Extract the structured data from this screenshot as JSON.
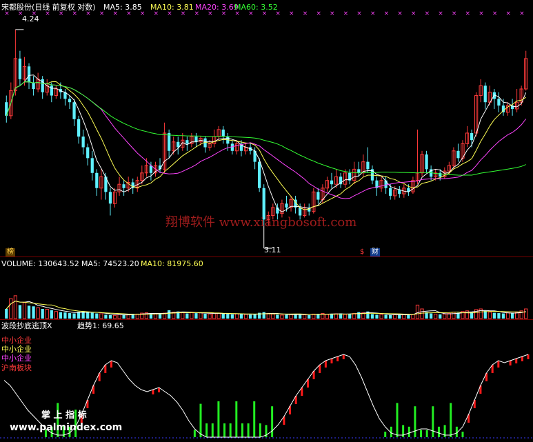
{
  "header": {
    "title": "宋都股份(日线 前复权 对数)",
    "ma5": "MA5: 3.85",
    "ma10": "MA10: 3.81",
    "ma20": "MA20: 3.69",
    "ma60": "MA60: 3.52"
  },
  "annotations": {
    "high": "4.24",
    "low": "3.11",
    "badge_left": "榜",
    "badge_dollar": "$",
    "badge_right": "财"
  },
  "volume_header": {
    "volume": "VOLUME: 130643.52",
    "ma5": "MA5: 74523.20",
    "ma10": "MA10: 81975.60"
  },
  "indicator_header": {
    "name": "波段抄底逃顶X",
    "trend": "趋势1: 69.65"
  },
  "indicator_legend": [
    "中小企业",
    "中小企业",
    "中小企业",
    "沪南板块"
  ],
  "watermarks": {
    "main": "翔博软件 www.xiangbosoft.com",
    "bottom_left": "掌 上 指 标",
    "bottom_site": "www.palmindex.com"
  },
  "colors": {
    "up": "#ff3a3a",
    "down": "#5ff0ff",
    "ma5": "#ffffff",
    "ma10": "#ffff55",
    "ma20": "#ff44ff",
    "ma60": "#33ff33",
    "separator": "#7a0000"
  },
  "chart_data": [
    {
      "type": "candlestick",
      "title": "宋都股份(日线 前复权 对数)",
      "ylim": [
        3.05,
        4.3
      ],
      "scale": "log",
      "grid": false,
      "marked_high": 4.24,
      "marked_low": 3.11,
      "candles": [
        {
          "o": 3.78,
          "c": 3.7,
          "h": 3.82,
          "l": 3.66
        },
        {
          "o": 3.7,
          "c": 3.85,
          "h": 3.9,
          "l": 3.68
        },
        {
          "o": 3.85,
          "c": 4.05,
          "h": 4.24,
          "l": 3.82
        },
        {
          "o": 4.05,
          "c": 3.92,
          "h": 4.1,
          "l": 3.88
        },
        {
          "o": 3.92,
          "c": 4.0,
          "h": 4.06,
          "l": 3.88
        },
        {
          "o": 4.0,
          "c": 3.9,
          "h": 4.02,
          "l": 3.86
        },
        {
          "o": 3.9,
          "c": 3.86,
          "h": 3.94,
          "l": 3.82
        },
        {
          "o": 3.86,
          "c": 3.92,
          "h": 3.96,
          "l": 3.84
        },
        {
          "o": 3.92,
          "c": 3.84,
          "h": 3.94,
          "l": 3.8
        },
        {
          "o": 3.84,
          "c": 3.88,
          "h": 3.92,
          "l": 3.82
        },
        {
          "o": 3.88,
          "c": 3.82,
          "h": 3.9,
          "l": 3.78
        },
        {
          "o": 3.82,
          "c": 3.86,
          "h": 3.88,
          "l": 3.8
        },
        {
          "o": 3.86,
          "c": 3.84,
          "h": 3.9,
          "l": 3.8
        },
        {
          "o": 3.84,
          "c": 3.8,
          "h": 3.86,
          "l": 3.76
        },
        {
          "o": 3.8,
          "c": 3.78,
          "h": 3.82,
          "l": 3.74
        },
        {
          "o": 3.78,
          "c": 3.68,
          "h": 3.8,
          "l": 3.64
        },
        {
          "o": 3.68,
          "c": 3.58,
          "h": 3.7,
          "l": 3.54
        },
        {
          "o": 3.58,
          "c": 3.52,
          "h": 3.62,
          "l": 3.48
        },
        {
          "o": 3.52,
          "c": 3.46,
          "h": 3.54,
          "l": 3.42
        },
        {
          "o": 3.46,
          "c": 3.38,
          "h": 3.5,
          "l": 3.34
        },
        {
          "o": 3.38,
          "c": 3.3,
          "h": 3.4,
          "l": 3.26
        },
        {
          "o": 3.3,
          "c": 3.36,
          "h": 3.4,
          "l": 3.24
        },
        {
          "o": 3.36,
          "c": 3.28,
          "h": 3.38,
          "l": 3.24
        },
        {
          "o": 3.28,
          "c": 3.22,
          "h": 3.3,
          "l": 3.16
        },
        {
          "o": 3.22,
          "c": 3.28,
          "h": 3.3,
          "l": 3.2
        },
        {
          "o": 3.28,
          "c": 3.32,
          "h": 3.36,
          "l": 3.26
        },
        {
          "o": 3.32,
          "c": 3.3,
          "h": 3.34,
          "l": 3.26
        },
        {
          "o": 3.3,
          "c": 3.33,
          "h": 3.36,
          "l": 3.28
        },
        {
          "o": 3.33,
          "c": 3.3,
          "h": 3.35,
          "l": 3.27
        },
        {
          "o": 3.3,
          "c": 3.34,
          "h": 3.36,
          "l": 3.28
        },
        {
          "o": 3.34,
          "c": 3.38,
          "h": 3.42,
          "l": 3.32
        },
        {
          "o": 3.38,
          "c": 3.42,
          "h": 3.46,
          "l": 3.36
        },
        {
          "o": 3.42,
          "c": 3.38,
          "h": 3.44,
          "l": 3.34
        },
        {
          "o": 3.38,
          "c": 3.42,
          "h": 3.44,
          "l": 3.36
        },
        {
          "o": 3.42,
          "c": 3.4,
          "h": 3.46,
          "l": 3.38
        },
        {
          "o": 3.4,
          "c": 3.6,
          "h": 3.66,
          "l": 3.38
        },
        {
          "o": 3.6,
          "c": 3.5,
          "h": 3.62,
          "l": 3.46
        },
        {
          "o": 3.5,
          "c": 3.55,
          "h": 3.58,
          "l": 3.48
        },
        {
          "o": 3.55,
          "c": 3.52,
          "h": 3.58,
          "l": 3.48
        },
        {
          "o": 3.52,
          "c": 3.56,
          "h": 3.6,
          "l": 3.5
        },
        {
          "o": 3.56,
          "c": 3.54,
          "h": 3.58,
          "l": 3.5
        },
        {
          "o": 3.54,
          "c": 3.58,
          "h": 3.6,
          "l": 3.52
        },
        {
          "o": 3.58,
          "c": 3.55,
          "h": 3.6,
          "l": 3.52
        },
        {
          "o": 3.55,
          "c": 3.57,
          "h": 3.58,
          "l": 3.53
        },
        {
          "o": 3.57,
          "c": 3.52,
          "h": 3.58,
          "l": 3.49
        },
        {
          "o": 3.52,
          "c": 3.54,
          "h": 3.56,
          "l": 3.5
        },
        {
          "o": 3.54,
          "c": 3.58,
          "h": 3.62,
          "l": 3.52
        },
        {
          "o": 3.58,
          "c": 3.62,
          "h": 3.64,
          "l": 3.56
        },
        {
          "o": 3.62,
          "c": 3.58,
          "h": 3.64,
          "l": 3.54
        },
        {
          "o": 3.58,
          "c": 3.54,
          "h": 3.6,
          "l": 3.5
        },
        {
          "o": 3.54,
          "c": 3.5,
          "h": 3.56,
          "l": 3.48
        },
        {
          "o": 3.5,
          "c": 3.54,
          "h": 3.56,
          "l": 3.48
        },
        {
          "o": 3.54,
          "c": 3.5,
          "h": 3.56,
          "l": 3.47
        },
        {
          "o": 3.5,
          "c": 3.52,
          "h": 3.54,
          "l": 3.48
        },
        {
          "o": 3.52,
          "c": 3.5,
          "h": 3.54,
          "l": 3.48
        },
        {
          "o": 3.5,
          "c": 3.44,
          "h": 3.52,
          "l": 3.4
        },
        {
          "o": 3.44,
          "c": 3.3,
          "h": 3.46,
          "l": 3.28
        },
        {
          "o": 3.3,
          "c": 3.14,
          "h": 3.32,
          "l": 3.11
        },
        {
          "o": 3.14,
          "c": 3.16,
          "h": 3.18,
          "l": 3.11
        },
        {
          "o": 3.16,
          "c": 3.2,
          "h": 3.22,
          "l": 3.14
        },
        {
          "o": 3.2,
          "c": 3.17,
          "h": 3.22,
          "l": 3.14
        },
        {
          "o": 3.17,
          "c": 3.22,
          "h": 3.24,
          "l": 3.15
        },
        {
          "o": 3.22,
          "c": 3.2,
          "h": 3.26,
          "l": 3.18
        },
        {
          "o": 3.2,
          "c": 3.24,
          "h": 3.26,
          "l": 3.18
        },
        {
          "o": 3.24,
          "c": 3.2,
          "h": 3.26,
          "l": 3.17
        },
        {
          "o": 3.2,
          "c": 3.16,
          "h": 3.22,
          "l": 3.14
        },
        {
          "o": 3.16,
          "c": 3.2,
          "h": 3.22,
          "l": 3.15
        },
        {
          "o": 3.2,
          "c": 3.18,
          "h": 3.22,
          "l": 3.16
        },
        {
          "o": 3.18,
          "c": 3.28,
          "h": 3.3,
          "l": 3.17
        },
        {
          "o": 3.28,
          "c": 3.24,
          "h": 3.3,
          "l": 3.22
        },
        {
          "o": 3.24,
          "c": 3.3,
          "h": 3.32,
          "l": 3.22
        },
        {
          "o": 3.3,
          "c": 3.34,
          "h": 3.36,
          "l": 3.28
        },
        {
          "o": 3.34,
          "c": 3.32,
          "h": 3.38,
          "l": 3.3
        },
        {
          "o": 3.32,
          "c": 3.36,
          "h": 3.4,
          "l": 3.3
        },
        {
          "o": 3.36,
          "c": 3.32,
          "h": 3.38,
          "l": 3.3
        },
        {
          "o": 3.32,
          "c": 3.38,
          "h": 3.4,
          "l": 3.3
        },
        {
          "o": 3.38,
          "c": 3.34,
          "h": 3.4,
          "l": 3.32
        },
        {
          "o": 3.34,
          "c": 3.4,
          "h": 3.44,
          "l": 3.32
        },
        {
          "o": 3.4,
          "c": 3.38,
          "h": 3.44,
          "l": 3.36
        },
        {
          "o": 3.38,
          "c": 3.44,
          "h": 3.48,
          "l": 3.36
        },
        {
          "o": 3.44,
          "c": 3.4,
          "h": 3.52,
          "l": 3.38
        },
        {
          "o": 3.4,
          "c": 3.34,
          "h": 3.42,
          "l": 3.32
        },
        {
          "o": 3.34,
          "c": 3.3,
          "h": 3.36,
          "l": 3.26
        },
        {
          "o": 3.3,
          "c": 3.34,
          "h": 3.36,
          "l": 3.28
        },
        {
          "o": 3.34,
          "c": 3.3,
          "h": 3.36,
          "l": 3.27
        },
        {
          "o": 3.3,
          "c": 3.26,
          "h": 3.32,
          "l": 3.24
        },
        {
          "o": 3.26,
          "c": 3.29,
          "h": 3.31,
          "l": 3.24
        },
        {
          "o": 3.29,
          "c": 3.27,
          "h": 3.31,
          "l": 3.25
        },
        {
          "o": 3.27,
          "c": 3.3,
          "h": 3.32,
          "l": 3.25
        },
        {
          "o": 3.3,
          "c": 3.28,
          "h": 3.32,
          "l": 3.26
        },
        {
          "o": 3.28,
          "c": 3.34,
          "h": 3.36,
          "l": 3.27
        },
        {
          "o": 3.34,
          "c": 3.38,
          "h": 3.62,
          "l": 3.32
        },
        {
          "o": 3.38,
          "c": 3.48,
          "h": 3.5,
          "l": 3.36
        },
        {
          "o": 3.48,
          "c": 3.4,
          "h": 3.5,
          "l": 3.38
        },
        {
          "o": 3.4,
          "c": 3.36,
          "h": 3.42,
          "l": 3.34
        },
        {
          "o": 3.36,
          "c": 3.38,
          "h": 3.4,
          "l": 3.34
        },
        {
          "o": 3.38,
          "c": 3.36,
          "h": 3.4,
          "l": 3.34
        },
        {
          "o": 3.36,
          "c": 3.39,
          "h": 3.41,
          "l": 3.35
        },
        {
          "o": 3.39,
          "c": 3.42,
          "h": 3.44,
          "l": 3.37
        },
        {
          "o": 3.42,
          "c": 3.5,
          "h": 3.52,
          "l": 3.4
        },
        {
          "o": 3.5,
          "c": 3.46,
          "h": 3.54,
          "l": 3.44
        },
        {
          "o": 3.46,
          "c": 3.54,
          "h": 3.56,
          "l": 3.44
        },
        {
          "o": 3.54,
          "c": 3.6,
          "h": 3.64,
          "l": 3.52
        },
        {
          "o": 3.6,
          "c": 3.56,
          "h": 3.62,
          "l": 3.52
        },
        {
          "o": 3.6,
          "c": 3.82,
          "h": 3.84,
          "l": 3.58
        },
        {
          "o": 3.82,
          "c": 3.88,
          "h": 3.92,
          "l": 3.78
        },
        {
          "o": 3.88,
          "c": 3.78,
          "h": 3.9,
          "l": 3.74
        },
        {
          "o": 3.78,
          "c": 3.84,
          "h": 3.88,
          "l": 3.76
        },
        {
          "o": 3.84,
          "c": 3.8,
          "h": 3.86,
          "l": 3.74
        },
        {
          "o": 3.8,
          "c": 3.76,
          "h": 3.84,
          "l": 3.72
        },
        {
          "o": 3.76,
          "c": 3.72,
          "h": 3.8,
          "l": 3.7
        },
        {
          "o": 3.72,
          "c": 3.76,
          "h": 3.78,
          "l": 3.7
        },
        {
          "o": 3.76,
          "c": 3.74,
          "h": 3.8,
          "l": 3.7
        },
        {
          "o": 3.74,
          "c": 3.78,
          "h": 3.86,
          "l": 3.72
        },
        {
          "o": 3.78,
          "c": 3.86,
          "h": 3.88,
          "l": 3.76
        },
        {
          "o": 3.86,
          "c": 4.05,
          "h": 4.1,
          "l": 3.85
        }
      ],
      "series": [
        {
          "name": "MA5",
          "color": "#ffffff"
        },
        {
          "name": "MA10",
          "color": "#ffff55"
        },
        {
          "name": "MA20",
          "color": "#ff44ff"
        },
        {
          "name": "MA60",
          "color": "#33ff33"
        }
      ]
    },
    {
      "type": "bar",
      "title": "VOLUME: 130643.52",
      "ylim": [
        0,
        150000
      ],
      "values": [
        30000,
        62000,
        71000,
        42000,
        50000,
        40000,
        38000,
        34000,
        30000,
        29000,
        26000,
        22000,
        20000,
        19000,
        17000,
        16000,
        21000,
        23000,
        20000,
        18000,
        16000,
        15000,
        12000,
        11000,
        10000,
        12000,
        13000,
        12000,
        15000,
        14000,
        17000,
        18000,
        16000,
        15000,
        14000,
        17000,
        26000,
        20000,
        22000,
        18000,
        16000,
        20000,
        17000,
        18000,
        15000,
        14000,
        16000,
        17000,
        15000,
        14000,
        13000,
        15000,
        14000,
        13000,
        12000,
        13000,
        18000,
        20000,
        16000,
        14000,
        12000,
        11000,
        12000,
        13000,
        14000,
        13000,
        12000,
        11000,
        14000,
        15000,
        16000,
        13000,
        14000,
        15000,
        16000,
        13000,
        15000,
        16000,
        20000,
        18000,
        22000,
        14000,
        12000,
        13000,
        12000,
        11000,
        12000,
        13000,
        12000,
        11000,
        13000,
        42000,
        30000,
        20000,
        16000,
        14000,
        13000,
        14000,
        16000,
        20000,
        18000,
        22000,
        24000,
        20000,
        28000,
        30000,
        24000,
        20000,
        18000,
        17000,
        16000,
        18000,
        17000,
        19000,
        24000,
        30000
      ],
      "ma5_series": "MA5: 74523.20",
      "ma10_series": "MA10: 81975.60"
    },
    {
      "type": "line",
      "title": "波段抄底逃顶X",
      "series": [
        {
          "name": "趋势1",
          "last": 69.65
        }
      ],
      "ylim": [
        0,
        100
      ],
      "trend": [
        55,
        50,
        42,
        34,
        26,
        20,
        14,
        8,
        4,
        2,
        2,
        4,
        10,
        22,
        36,
        50,
        62,
        70,
        74,
        72,
        64,
        56,
        50,
        46,
        44,
        46,
        48,
        44,
        40,
        34,
        26,
        16,
        8,
        3,
        0,
        0,
        0,
        0,
        0,
        0,
        0,
        0,
        0,
        0,
        2,
        6,
        12,
        20,
        30,
        40,
        48,
        56,
        64,
        70,
        74,
        76,
        78,
        80,
        78,
        70,
        58,
        44,
        30,
        18,
        10,
        4,
        2,
        2,
        4,
        6,
        8,
        8,
        6,
        4,
        2,
        2,
        4,
        10,
        22,
        36,
        50,
        62,
        70,
        74,
        72,
        74,
        76,
        78,
        80
      ],
      "spikes": [
        0,
        0,
        0,
        0,
        0,
        0,
        0,
        0,
        0,
        0,
        0,
        0,
        0,
        0,
        0,
        0,
        0,
        0,
        0,
        0,
        0,
        0,
        0,
        0,
        0,
        0,
        0,
        0,
        0,
        0,
        0,
        0,
        0,
        0,
        0,
        0,
        0,
        0,
        0,
        0,
        0,
        0,
        0,
        0,
        0,
        0,
        0,
        0,
        0,
        0,
        0,
        0,
        0,
        0,
        0,
        0,
        0,
        0,
        0,
        0,
        0,
        0,
        0,
        0,
        0,
        0,
        0,
        0,
        0,
        0,
        0,
        0,
        0,
        0,
        0,
        0,
        0,
        0,
        0,
        0,
        0,
        0,
        0,
        0,
        0,
        0,
        0,
        0,
        0
      ]
    }
  ]
}
